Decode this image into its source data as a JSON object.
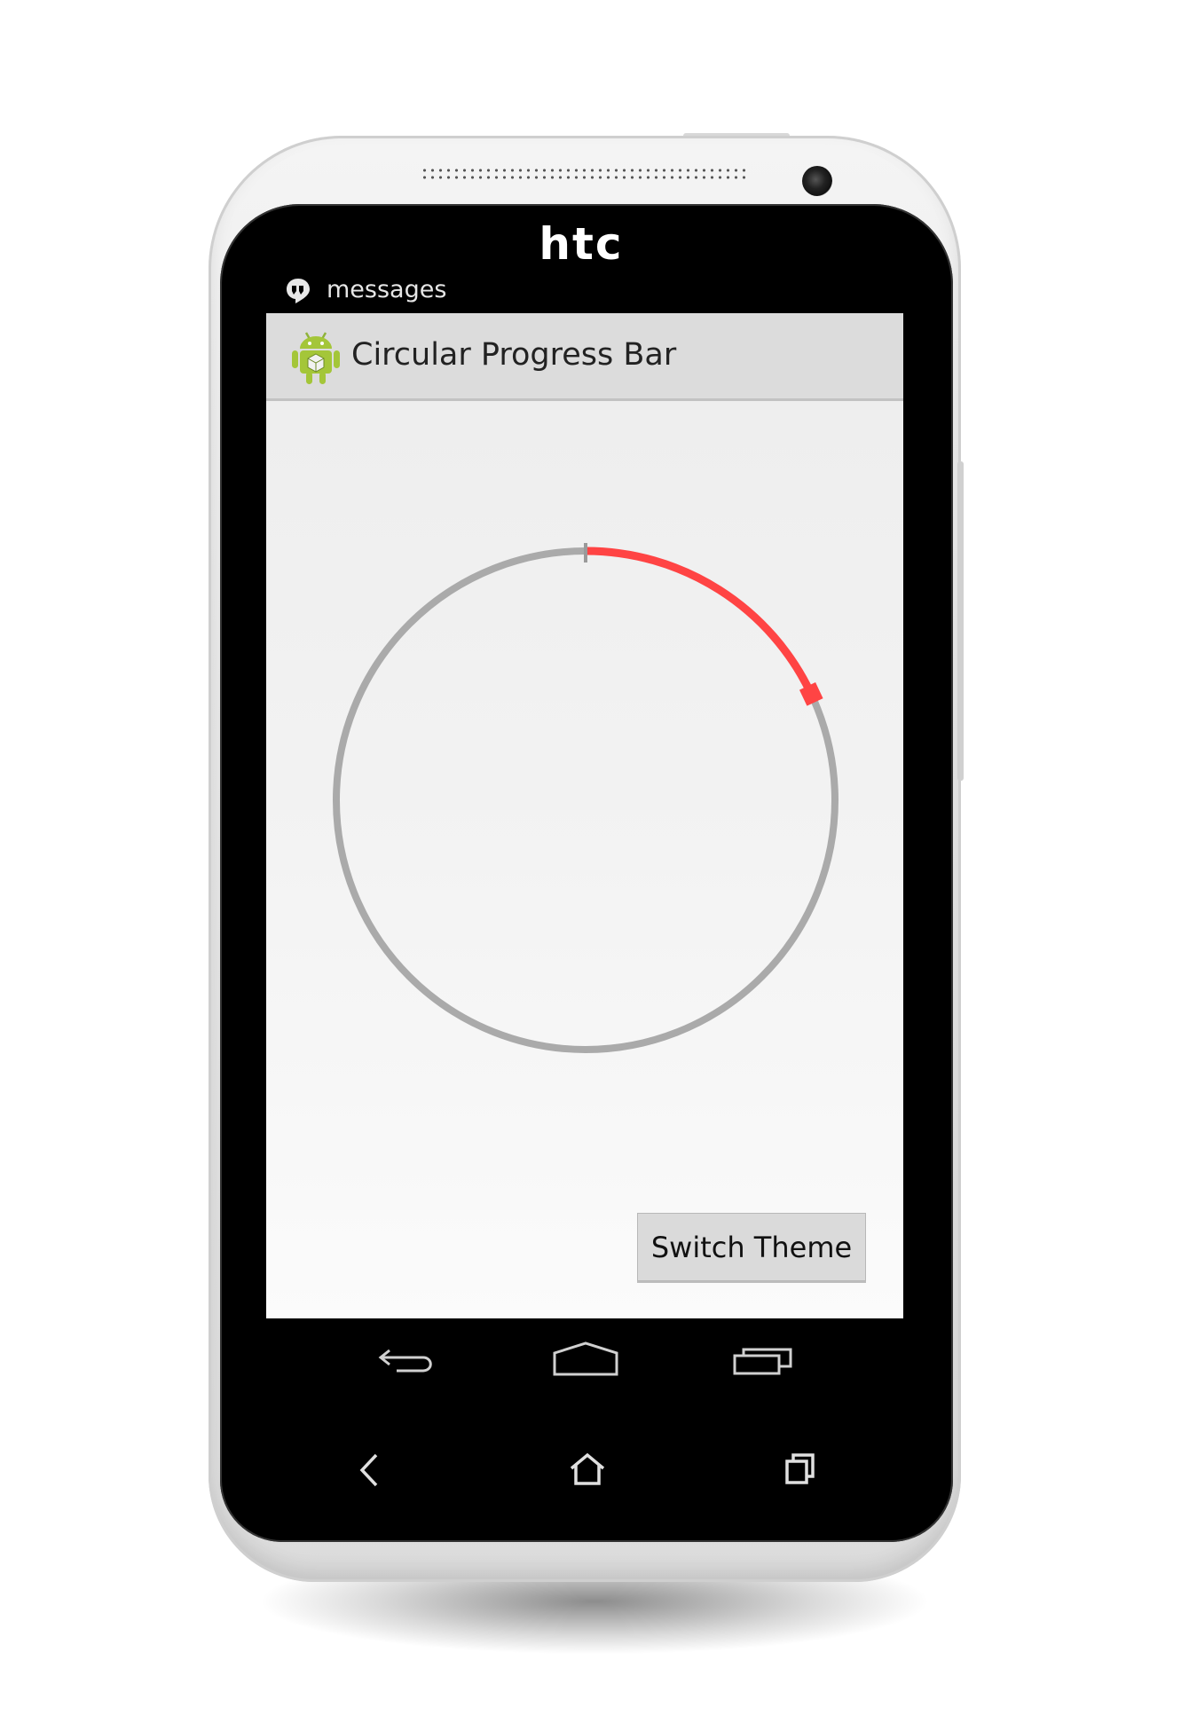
{
  "device": {
    "brand": "htc"
  },
  "status_bar": {
    "notification_icon": "hangouts-quote-icon",
    "notification_text": "messages"
  },
  "action_bar": {
    "app_icon": "android-robot-icon",
    "title": "Circular Progress Bar"
  },
  "progress": {
    "value_fraction": 0.18,
    "progress_color": "#ff4444",
    "track_color": "#aaaaaa",
    "marker_color": "#9a9a9a"
  },
  "button": {
    "label": "Switch Theme"
  },
  "nav_bar": {
    "icons": [
      "back-icon",
      "home-icon",
      "recent-apps-icon"
    ]
  },
  "hardware_keys": {
    "icons": [
      "back-icon",
      "home-icon",
      "recent-apps-icon"
    ]
  },
  "colors": {
    "screen_bg": "#f0f0f0",
    "action_bar_bg": "#dcdcdc",
    "accent": "#ff4444"
  }
}
